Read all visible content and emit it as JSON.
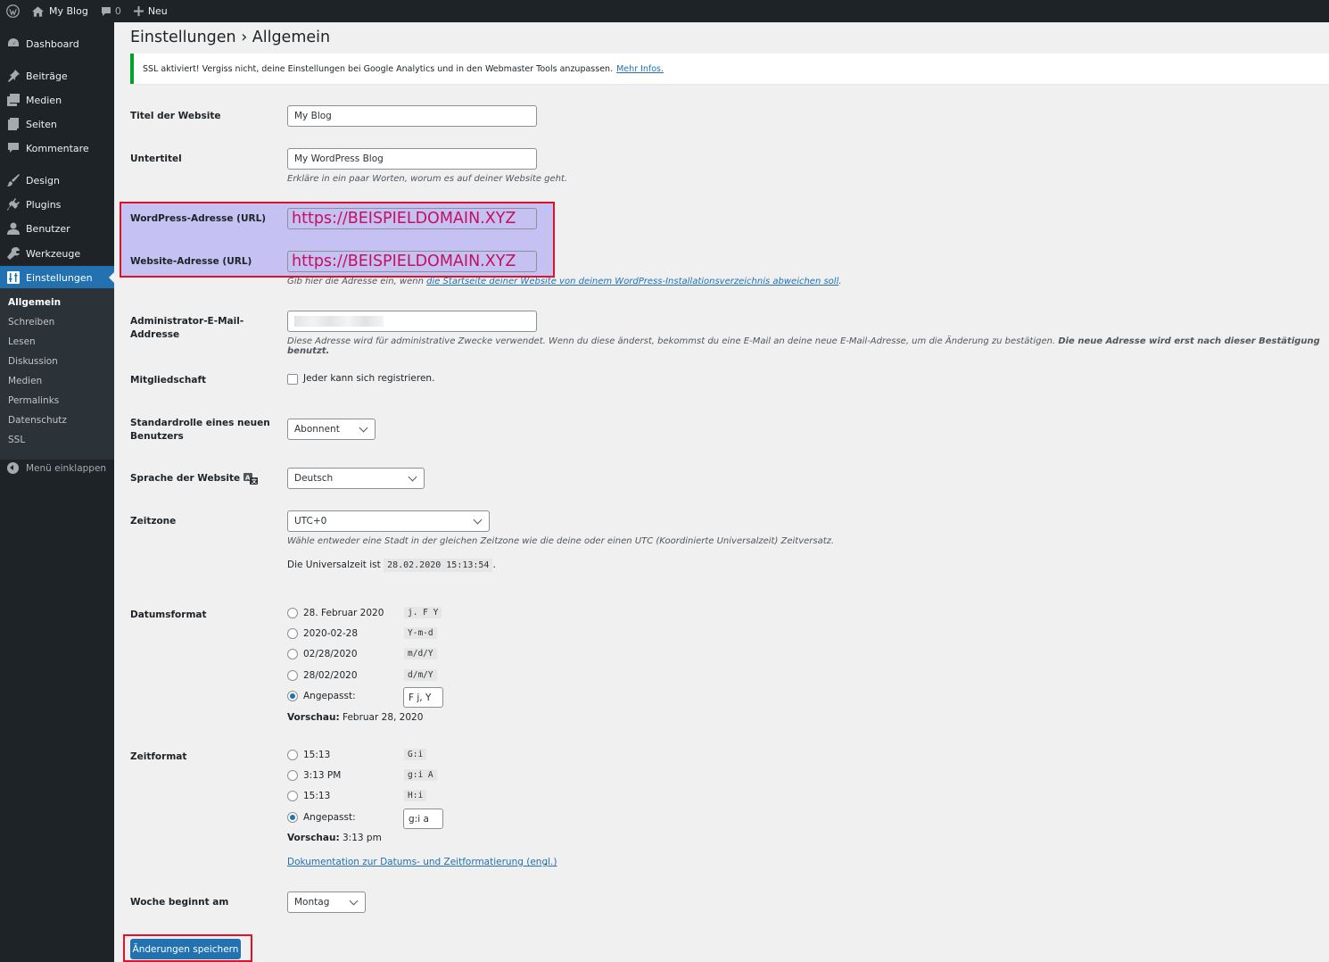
{
  "adminbar": {
    "site_name": "My Blog",
    "comments_count": "0",
    "new_label": "Neu"
  },
  "sidebar": {
    "items": [
      {
        "label": "Dashboard",
        "icon": "dashboard-icon"
      },
      {
        "label": "Beiträge",
        "icon": "pin-icon"
      },
      {
        "label": "Medien",
        "icon": "media-icon"
      },
      {
        "label": "Seiten",
        "icon": "page-icon"
      },
      {
        "label": "Kommentare",
        "icon": "comment-icon"
      },
      {
        "label": "Design",
        "icon": "brush-icon"
      },
      {
        "label": "Plugins",
        "icon": "plugin-icon"
      },
      {
        "label": "Benutzer",
        "icon": "user-icon"
      },
      {
        "label": "Werkzeuge",
        "icon": "wrench-icon"
      },
      {
        "label": "Einstellungen",
        "icon": "settings-icon"
      }
    ],
    "submenu": [
      "Allgemein",
      "Schreiben",
      "Lesen",
      "Diskussion",
      "Medien",
      "Permalinks",
      "Datenschutz",
      "SSL"
    ],
    "collapse_label": "Menü einklappen"
  },
  "page": {
    "title": "Einstellungen › Allgemein"
  },
  "notice": {
    "text": "SSL aktiviert! Vergiss nicht, deine Einstellungen bei Google Analytics und in den Webmaster Tools anzupassen.",
    "link": "Mehr Infos."
  },
  "form": {
    "site_title": {
      "label": "Titel der Website",
      "value": "My Blog"
    },
    "tagline": {
      "label": "Untertitel",
      "value": "My WordPress Blog",
      "description": "Erkläre in ein paar Worten, worum es auf deiner Website geht."
    },
    "wp_url": {
      "label": "WordPress-Adresse (URL)",
      "value": "https://BEISPIELDOMAIN.XYZ"
    },
    "site_url": {
      "label": "Website-Adresse (URL)",
      "value": "https://BEISPIELDOMAIN.XYZ",
      "desc_prefix": "Gib hier die Adresse ein, wenn",
      "desc_link": "die Startseite deiner Website von deinem WordPress-Installationsverzeichnis abweichen soll",
      "desc_suffix": "."
    },
    "admin_email": {
      "label_line1": "Administrator-E-Mail-",
      "label_line2": "Addresse",
      "desc": "Diese Adresse wird für administrative Zwecke verwendet. Wenn du diese änderst, bekommst du eine E-Mail an deine neue E-Mail-Adresse, um die Änderung zu bestätigen.",
      "desc_bold": "Die neue Adresse wird erst nach dieser Bestätigung benutzt."
    },
    "membership": {
      "label": "Mitgliedschaft",
      "checkbox_label": "Jeder kann sich registrieren."
    },
    "default_role": {
      "label_line1": "Standardrolle eines neuen",
      "label_line2": "Benutzers",
      "value": "Abonnent"
    },
    "language": {
      "label": "Sprache der Website",
      "value": "Deutsch"
    },
    "timezone": {
      "label": "Zeitzone",
      "value": "UTC+0",
      "description": "Wähle entweder eine Stadt in der gleichen Zeitzone wie die deine oder einen UTC (Koordinierte Universalzeit) Zeitversatz.",
      "utc_prefix": "Die Universalzeit ist",
      "utc_value": "28.02.2020 15:13:54",
      "utc_suffix": "."
    },
    "date_format": {
      "label": "Datumsformat",
      "options": [
        {
          "label": "28. Februar 2020",
          "code": "j. F Y"
        },
        {
          "label": "2020-02-28",
          "code": "Y-m-d"
        },
        {
          "label": "02/28/2020",
          "code": "m/d/Y"
        },
        {
          "label": "28/02/2020",
          "code": "d/m/Y"
        }
      ],
      "custom_label": "Angepasst:",
      "custom_value": "F j, Y",
      "preview_label": "Vorschau:",
      "preview_value": "Februar 28, 2020"
    },
    "time_format": {
      "label": "Zeitformat",
      "options": [
        {
          "label": "15:13",
          "code": "G:i"
        },
        {
          "label": "3:13 PM",
          "code": "g:i A"
        },
        {
          "label": "15:13",
          "code": "H:i"
        }
      ],
      "custom_label": "Angepasst:",
      "custom_value": "g:i a",
      "preview_label": "Vorschau:",
      "preview_value": "3:13 pm"
    },
    "doc_link": "Dokumentation zur Datums- und Zeitformatierung (engl.)",
    "doc_link_suffix": ".",
    "week_start": {
      "label": "Woche beginnt am",
      "value": "Montag"
    },
    "save_label": "Änderungen speichern"
  },
  "colors": {
    "sidebar_bg": "#1d2327",
    "accent": "#2271b1",
    "highlight_fill": "#c5c1f2",
    "highlight_border": "#e1112a",
    "url_text": "#c6105f"
  }
}
